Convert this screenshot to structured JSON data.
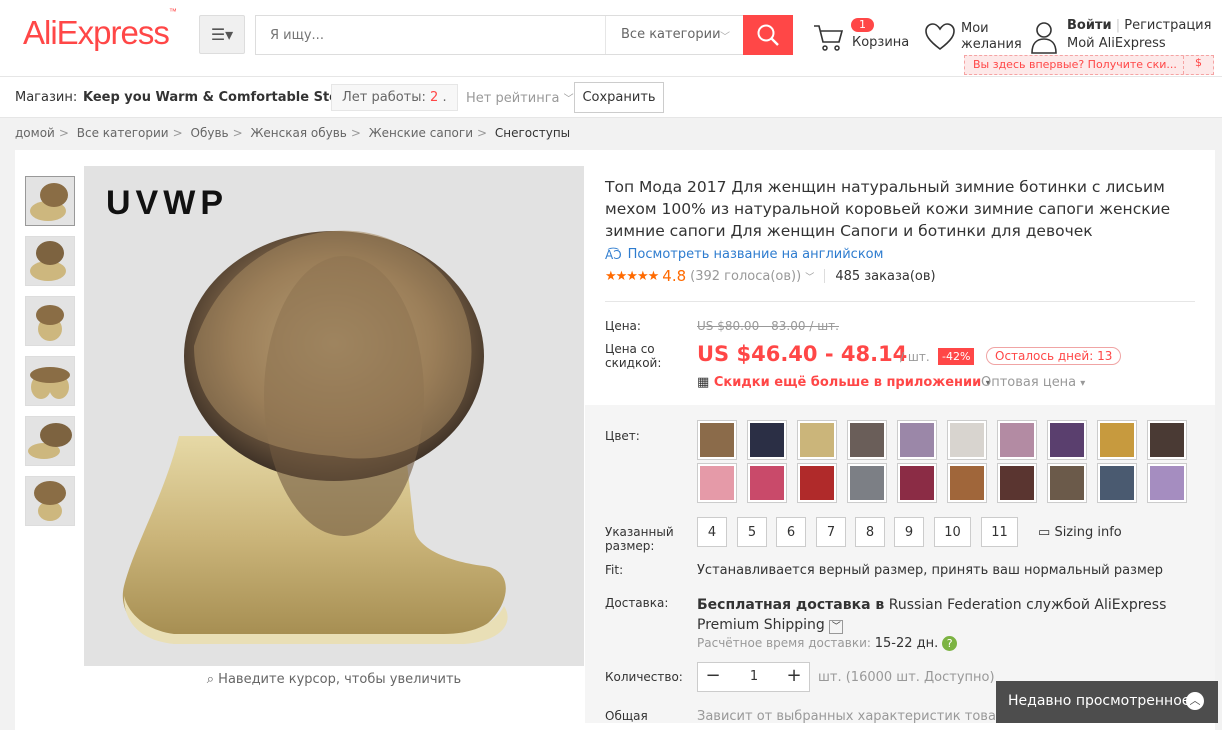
{
  "header": {
    "logo": "AliExpress",
    "search_placeholder": "Я ищу...",
    "category": "Все категории",
    "cart_count": "1",
    "cart_label": "Корзина",
    "wishlist_line1": "Мои",
    "wishlist_line2": "желания",
    "login": "Войти",
    "register": "Регистрация",
    "my_account": "Мой AliExpress",
    "promo": "Вы здесь впервые? Получите ски...",
    "promo_icon": "$"
  },
  "store": {
    "label": "Магазин:",
    "name": "Keep you Warm & Comfortable Store",
    "years_label": "Лет работы:",
    "years_value": "2",
    "rating": "Нет рейтинга",
    "save": "Сохранить"
  },
  "breadcrumb": [
    "домой",
    "Все категории",
    "Обувь",
    "Женская обувь",
    "Женские сапоги",
    "Снегоступы"
  ],
  "gallery": {
    "brand": "UVWP",
    "zoom_hint": "Наведите курсор, чтобы увеличить"
  },
  "product": {
    "title": "Топ Мода 2017 Для женщин натуральный зимние ботинки с лисьим мехом 100% из натуральной коровьей кожи зимние сапоги женские зимние сапоги Для женщин Сапоги и ботинки для девочек",
    "translate": "Посмотреть название на английском",
    "rating": "4.8",
    "votes": "(392 голоса(ов))",
    "orders": "485 заказа(ов)",
    "price_label": "Цена:",
    "old_price": "US $80.00 - 83.00 / шт.",
    "discount_label_1": "Цена со",
    "discount_label_2": "скидкой:",
    "new_price": "US $46.40 - 48.14",
    "unit": "/ шт.",
    "discount": "-42%",
    "days_left": "Осталось дней: 13",
    "app_discount": "Скидки ещё больше в приложении",
    "wholesale": "Оптовая цена"
  },
  "sku": {
    "color_label": "Цвет:",
    "size_label_1": "Указанный",
    "size_label_2": "размер:",
    "sizes": [
      "4",
      "5",
      "6",
      "7",
      "8",
      "9",
      "10",
      "11"
    ],
    "sizing_info": "Sizing info",
    "fit_label": "Fit:",
    "fit_value": "Устанавливается верный размер, принять ваш нормальный размер",
    "shipping_label": "Доставка:",
    "shipping_free": "Бесплатная доставка в",
    "shipping_rest": "Russian Federation службой AliExpress Premium Shipping",
    "delivery_label": "Расчётное время доставки:",
    "delivery_value": "15-22 дн.",
    "qty_label": "Количество:",
    "qty_value": "1",
    "qty_avail": "шт. (16000 шт. Доступно)",
    "total_label": "Общая",
    "total_value": "Зависит от выбранных характеристик товара"
  },
  "recently_viewed": "Недавно просмотренное",
  "colors": {
    "accent": "#ff4747",
    "rating": "#ff6a00",
    "link": "#2e7ccf"
  }
}
